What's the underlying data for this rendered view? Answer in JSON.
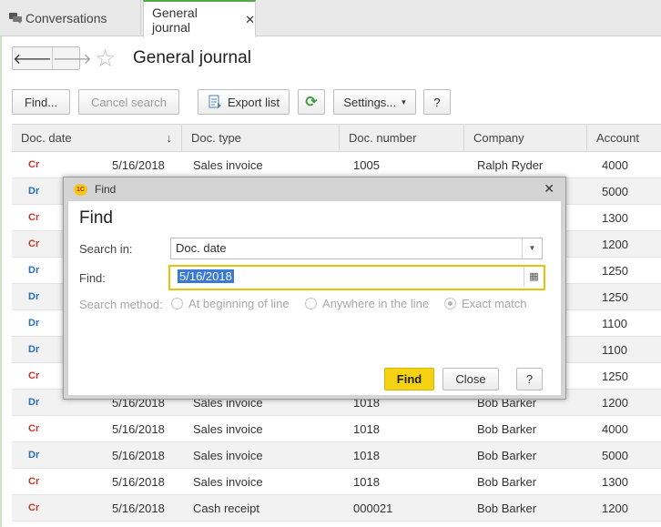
{
  "tabs": {
    "conversations": "Conversations",
    "general_journal": "General journal",
    "close_glyph": "✕"
  },
  "header": {
    "back": "🡐",
    "forward": "🡒",
    "star": "☆",
    "title": "General journal"
  },
  "toolbar": {
    "find": "Find...",
    "cancel_search": "Cancel search",
    "export_list": "Export list",
    "refresh": "⟳",
    "settings": "Settings...",
    "settings_caret": "▾",
    "help": "?"
  },
  "table": {
    "columns": [
      "Doc. date",
      "Doc. type",
      "Doc. number",
      "Company",
      "Account"
    ],
    "sort_indicator": "↓",
    "rows": [
      {
        "dc": "Cr",
        "date": "5/16/2018",
        "type": "Sales invoice",
        "number": "1005",
        "company": "Ralph Ryder",
        "account": "4000"
      },
      {
        "dc": "Dr",
        "date": "",
        "type": "",
        "number": "",
        "company": "",
        "account": "5000"
      },
      {
        "dc": "Cr",
        "date": "",
        "type": "",
        "number": "",
        "company": "",
        "account": "1300"
      },
      {
        "dc": "Cr",
        "date": "",
        "type": "",
        "number": "",
        "company": "",
        "account": "1200"
      },
      {
        "dc": "Dr",
        "date": "",
        "type": "",
        "number": "",
        "company": "",
        "account": "1250"
      },
      {
        "dc": "Dr",
        "date": "",
        "type": "",
        "number": "",
        "company": "",
        "account": "1250"
      },
      {
        "dc": "Dr",
        "date": "",
        "type": "",
        "number": "",
        "company": "",
        "account": "1100"
      },
      {
        "dc": "Dr",
        "date": "",
        "type": "",
        "number": "",
        "company": "",
        "account": "1100"
      },
      {
        "dc": "Cr",
        "date": "",
        "type": "",
        "number": "",
        "company": "",
        "account": "1250"
      },
      {
        "dc": "Dr",
        "date": "5/16/2018",
        "type": "Sales invoice",
        "number": "1018",
        "company": "Bob Barker",
        "account": "1200"
      },
      {
        "dc": "Cr",
        "date": "5/16/2018",
        "type": "Sales invoice",
        "number": "1018",
        "company": "Bob Barker",
        "account": "4000"
      },
      {
        "dc": "Dr",
        "date": "5/16/2018",
        "type": "Sales invoice",
        "number": "1018",
        "company": "Bob Barker",
        "account": "5000"
      },
      {
        "dc": "Cr",
        "date": "5/16/2018",
        "type": "Sales invoice",
        "number": "1018",
        "company": "Bob Barker",
        "account": "1300"
      },
      {
        "dc": "Cr",
        "date": "5/16/2018",
        "type": "Cash receipt",
        "number": "000021",
        "company": "Bob Barker",
        "account": "1200"
      }
    ]
  },
  "dialog": {
    "window_title": "Find",
    "logo": "1С",
    "close": "✕",
    "heading": "Find",
    "search_in_label": "Search in:",
    "search_in_value": "Doc. date",
    "dropdown_glyph": "▼",
    "find_label": "Find:",
    "find_value": "5/16/2018",
    "calendar_glyph": "▦",
    "search_method_label": "Search method:",
    "options": [
      "At beginning of line",
      "Anywhere in the line",
      "Exact match"
    ],
    "selected_option": "Exact match",
    "find_button": "Find",
    "close_button": "Close",
    "help_button": "?"
  },
  "colors": {
    "accent_green": "#55a84f",
    "credit_red": "#c0392b",
    "debit_blue": "#2a6fb5",
    "primary_yellow": "#f5d314",
    "selection_blue": "#3a78d6"
  }
}
